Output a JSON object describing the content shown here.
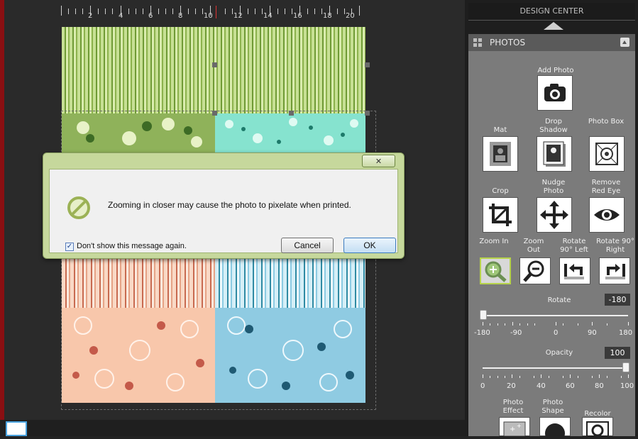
{
  "ruler": {
    "labels": [
      "2",
      "4",
      "6",
      "8",
      "10",
      "12",
      "14",
      "16",
      "18",
      "20"
    ]
  },
  "dialog": {
    "close_label": "✕",
    "message": "Zooming in closer may cause the photo to pixelate when printed.",
    "checkbox_label": "Don't show this message again.",
    "checkbox_checked": true,
    "cancel_label": "Cancel",
    "ok_label": "OK"
  },
  "design_center": {
    "header": "DESIGN CENTER",
    "panel_title": "PHOTOS",
    "add_photo_label": "Add Photo",
    "tools_row1": [
      "Mat",
      "Drop Shadow",
      "Photo Box"
    ],
    "tools_row2": [
      "Crop",
      "Nudge Photo",
      "Remove Red Eye"
    ],
    "tools_row3": [
      "Zoom In",
      "Zoom Out",
      "Rotate 90° Left",
      "Rotate 90° Right"
    ],
    "rotate": {
      "label": "Rotate",
      "value": "-180",
      "scale": [
        "-180",
        "-90",
        "0",
        "90",
        "180"
      ]
    },
    "opacity": {
      "label": "Opacity",
      "value": "100",
      "scale": [
        "0",
        "20",
        "40",
        "60",
        "80",
        "100"
      ]
    },
    "tools_row4": [
      "Photo Effect",
      "Photo Shape",
      "Recolor"
    ]
  },
  "colors": {
    "accent_red": "#8a0f12",
    "panel_gray": "#7b7b7b",
    "selected_green": "#b6d34a",
    "green_paper": "#9cc25e",
    "teal_paper": "#7fe0c8",
    "peach_paper": "#f7c4a8",
    "blue_paper": "#8ccbe3"
  }
}
